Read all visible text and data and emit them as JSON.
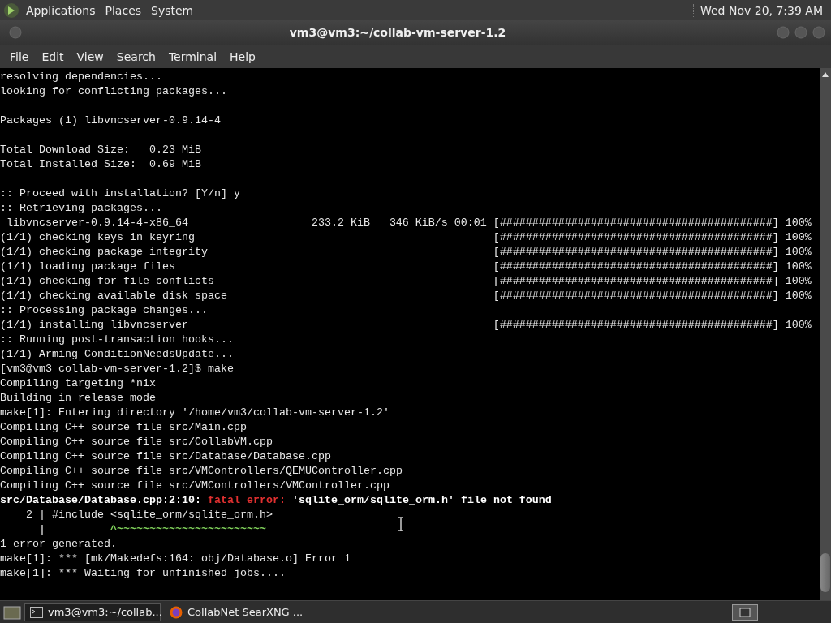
{
  "top_panel": {
    "menus": [
      "Applications",
      "Places",
      "System"
    ],
    "clock": "Wed Nov 20,  7:39 AM"
  },
  "window": {
    "title": "vm3@vm3:~/collab-vm-server-1.2",
    "menubar": [
      "File",
      "Edit",
      "View",
      "Search",
      "Terminal",
      "Help"
    ],
    "terminal": {
      "lines": [
        {
          "kind": "text",
          "text": "resolving dependencies..."
        },
        {
          "kind": "text",
          "text": "looking for conflicting packages..."
        },
        {
          "kind": "blank"
        },
        {
          "kind": "text",
          "text": "Packages (1) libvncserver-0.9.14-4"
        },
        {
          "kind": "blank"
        },
        {
          "kind": "text",
          "text": "Total Download Size:   0.23 MiB"
        },
        {
          "kind": "text",
          "text": "Total Installed Size:  0.69 MiB"
        },
        {
          "kind": "blank"
        },
        {
          "kind": "text",
          "text": ":: Proceed with installation? [Y/n] y"
        },
        {
          "kind": "text",
          "text": ":: Retrieving packages..."
        },
        {
          "kind": "download",
          "label": " libvncserver-0.9.14-4-x86_64",
          "size": "233.2 KiB",
          "rate": "346 KiB/s",
          "time": "00:01",
          "bar": "[##########################################]",
          "percent": "100%"
        },
        {
          "kind": "progress",
          "label": "(1/1) checking keys in keyring",
          "bar": "[##########################################]",
          "percent": "100%"
        },
        {
          "kind": "progress",
          "label": "(1/1) checking package integrity",
          "bar": "[##########################################]",
          "percent": "100%"
        },
        {
          "kind": "progress",
          "label": "(1/1) loading package files",
          "bar": "[##########################################]",
          "percent": "100%"
        },
        {
          "kind": "progress",
          "label": "(1/1) checking for file conflicts",
          "bar": "[##########################################]",
          "percent": "100%"
        },
        {
          "kind": "progress",
          "label": "(1/1) checking available disk space",
          "bar": "[##########################################]",
          "percent": "100%"
        },
        {
          "kind": "text",
          "text": ":: Processing package changes..."
        },
        {
          "kind": "progress",
          "label": "(1/1) installing libvncserver",
          "bar": "[##########################################]",
          "percent": "100%"
        },
        {
          "kind": "text",
          "text": ":: Running post-transaction hooks..."
        },
        {
          "kind": "text",
          "text": "(1/1) Arming ConditionNeedsUpdate..."
        },
        {
          "kind": "text",
          "text": "[vm3@vm3 collab-vm-server-1.2]$ make"
        },
        {
          "kind": "text",
          "text": "Compiling targeting *nix"
        },
        {
          "kind": "text",
          "text": "Building in release mode"
        },
        {
          "kind": "text",
          "text": "make[1]: Entering directory '/home/vm3/collab-vm-server-1.2'"
        },
        {
          "kind": "text",
          "text": "Compiling C++ source file src/Main.cpp"
        },
        {
          "kind": "text",
          "text": "Compiling C++ source file src/CollabVM.cpp"
        },
        {
          "kind": "text",
          "text": "Compiling C++ source file src/Database/Database.cpp"
        },
        {
          "kind": "text",
          "text": "Compiling C++ source file src/VMControllers/QEMUController.cpp"
        },
        {
          "kind": "text",
          "text": "Compiling C++ source file src/VMControllers/VMController.cpp"
        },
        {
          "kind": "parts",
          "parts": [
            {
              "kind": "bold",
              "text": "src/Database/Database.cpp:2:10: "
            },
            {
              "kind": "error",
              "text": "fatal error: "
            },
            {
              "kind": "bold",
              "text": "'sqlite_orm/sqlite_orm.h' file not found"
            }
          ]
        },
        {
          "kind": "text",
          "text": "    2 | #include <sqlite_orm/sqlite_orm.h>"
        },
        {
          "kind": "parts",
          "parts": [
            {
              "kind": "plain",
              "text": "      |          "
            },
            {
              "kind": "hint",
              "text": "^~~~~~~~~~~~~~~~~~~~~~~~"
            }
          ]
        },
        {
          "kind": "text",
          "text": "1 error generated."
        },
        {
          "kind": "text",
          "text": "make[1]: *** [mk/Makedefs:164: obj/Database.o] Error 1"
        },
        {
          "kind": "text",
          "text": "make[1]: *** Waiting for unfinished jobs...."
        }
      ]
    }
  },
  "taskbar": {
    "items": [
      {
        "label": "vm3@vm3:~/collab...",
        "kind": "terminal",
        "selected": true
      },
      {
        "label": "CollabNet SearXNG ...",
        "kind": "browser",
        "selected": false
      }
    ]
  }
}
